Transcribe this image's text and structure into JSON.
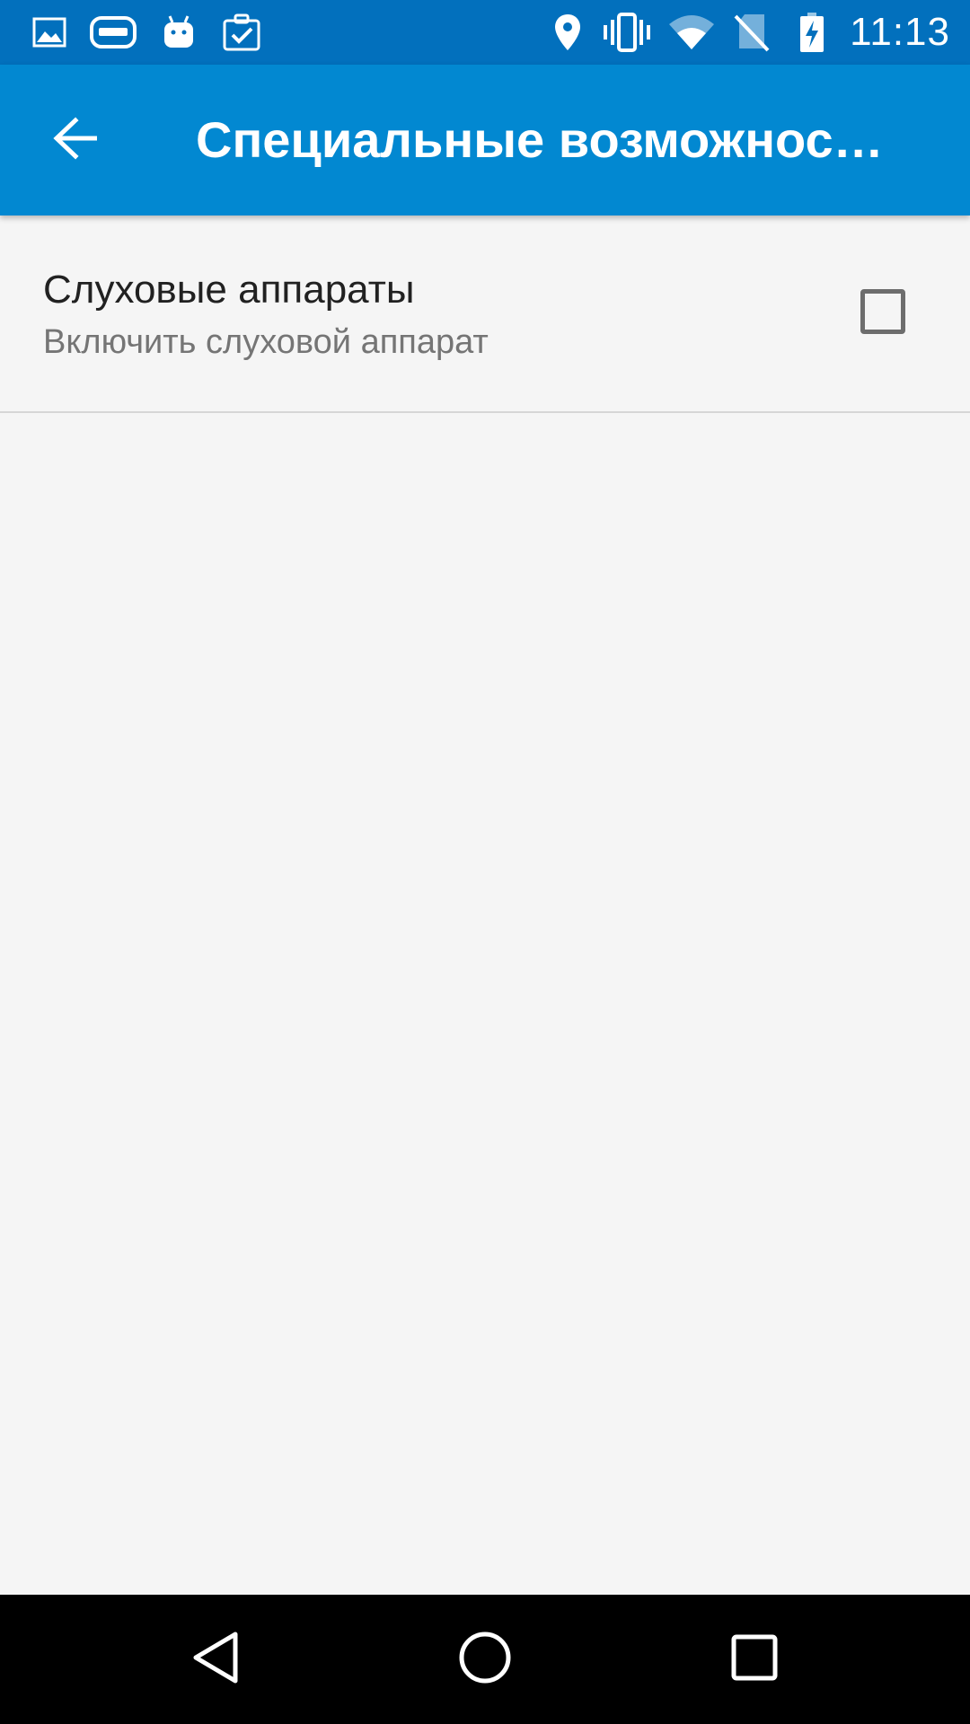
{
  "status_bar": {
    "time": "11:13",
    "left_icons": [
      "image-icon",
      "gamepad-icon",
      "android-icon",
      "clipboard-check-icon"
    ],
    "right_icons": [
      "location-pin-icon",
      "vibrate-icon",
      "wifi-icon",
      "no-sim-icon",
      "battery-charging-icon"
    ]
  },
  "app_bar": {
    "back_icon": "arrow-back-icon",
    "title": "Специальные возможнос…"
  },
  "preferences": [
    {
      "title": "Слуховые аппараты",
      "summary": "Включить слуховой аппарат",
      "checked": false
    }
  ],
  "nav_bar": {
    "buttons": [
      "back-triangle-icon",
      "home-circle-icon",
      "recents-square-icon"
    ]
  },
  "colors": {
    "status_bar": "#0270bd",
    "app_bar": "#0288d1",
    "background": "#f5f5f5",
    "nav_bar": "#000000"
  }
}
